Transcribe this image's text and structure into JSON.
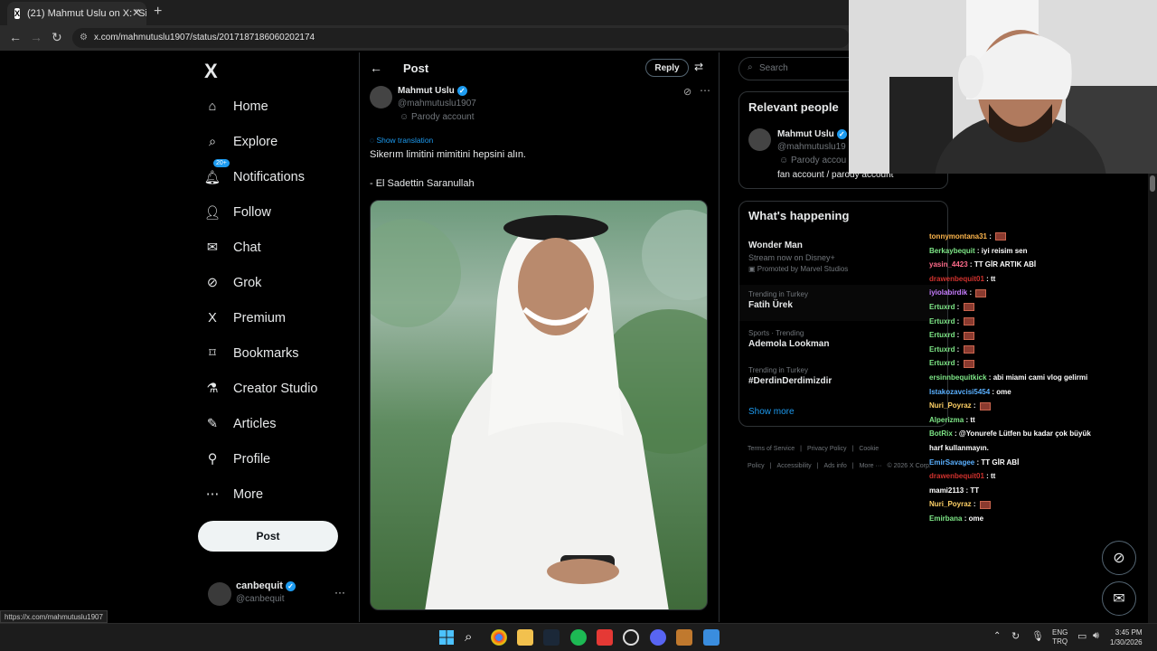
{
  "browser": {
    "tab_title": "(21) Mahmut Uslu on X: \"Sikeri",
    "tab_favicon": "X",
    "close_glyph": "✕",
    "newtab_glyph": "+",
    "url": "x.com/mahmutuslu1907/status/2017187186060202174",
    "status_url": "https://x.com/mahmutuslu1907"
  },
  "nav": {
    "logo": "X",
    "items": [
      {
        "label": "Home",
        "icon": "home-icon",
        "glyph": "⌂"
      },
      {
        "label": "Explore",
        "icon": "search-icon",
        "glyph": "⌕"
      },
      {
        "label": "Notifications",
        "icon": "bell-icon",
        "glyph": "🔔︎",
        "badge": "20+"
      },
      {
        "label": "Follow",
        "icon": "person-add-icon",
        "glyph": "👤︎"
      },
      {
        "label": "Chat",
        "icon": "mail-icon",
        "glyph": "✉"
      },
      {
        "label": "Grok",
        "icon": "grok-icon",
        "glyph": "⊘"
      },
      {
        "label": "Premium",
        "icon": "x-icon",
        "glyph": "X"
      },
      {
        "label": "Bookmarks",
        "icon": "bookmark-icon",
        "glyph": "⌑"
      },
      {
        "label": "Creator Studio",
        "icon": "flask-icon",
        "glyph": "⚗"
      },
      {
        "label": "Articles",
        "icon": "article-icon",
        "glyph": "✎"
      },
      {
        "label": "Profile",
        "icon": "person-icon",
        "glyph": "⚲"
      },
      {
        "label": "More",
        "icon": "more-circle-icon",
        "glyph": "⋯"
      }
    ],
    "post_button": "Post",
    "account": {
      "name": "canbequit",
      "handle": "@canbequit",
      "menu": "···"
    }
  },
  "post": {
    "header_title": "Post",
    "reply_button": "Reply",
    "author_name": "Mahmut Uslu",
    "author_handle": "@mahmutuslu1907",
    "parody_label": "Parody account",
    "show_translation": "Show translation",
    "text_line1": "Sikerım limitini mimitini hepsini alın.",
    "text_line2": "- El Sadettin Saranullah"
  },
  "right": {
    "search_placeholder": "Search",
    "relevant_title": "Relevant people",
    "relevant_name": "Mahmut Uslu",
    "relevant_handle": "@mahmutuslu19",
    "relevant_parody": "Parody accou",
    "relevant_bio": "fan account / parody account",
    "happening_title": "What's happening",
    "trends": [
      {
        "title": "Wonder Man",
        "sub": "Stream now on Disney+",
        "promo": "Promoted by Marvel Studios"
      },
      {
        "cat": "Trending in Turkey",
        "title": "Fatih Ürek"
      },
      {
        "cat": "Sports · Trending",
        "title": "Ademola Lookman"
      },
      {
        "cat": "Trending in Turkey",
        "title": "#DerdinDerdimizdir"
      }
    ],
    "show_more": "Show more",
    "footer": [
      "Terms of Service",
      "|",
      "Privacy Policy",
      "|",
      "Cookie Policy",
      "|",
      "Accessibility",
      "|",
      "Ads info",
      "|",
      "More ···",
      "© 2026 X Corp."
    ]
  },
  "chat": [
    {
      "user": "tonnymontana31",
      "color": "#ffb74d",
      "text": "",
      "emote": true
    },
    {
      "user": "Berkaybequit",
      "color": "#7ee787",
      "text": "iyi reisim sen",
      "emote": false
    },
    {
      "user": "yasin_4423",
      "color": "#ff6b8b",
      "text": "TT GİR ARTIK ABİ",
      "emote": false
    },
    {
      "user": "drawenbequit01",
      "color": "#d0312d",
      "text": "tt",
      "emote": false
    },
    {
      "user": "iyiolabirdik",
      "color": "#c77dff",
      "text": "",
      "emote": true
    },
    {
      "user": "Ertuxrd",
      "color": "#7ee787",
      "text": "",
      "emote": true
    },
    {
      "user": "Ertuxrd",
      "color": "#7ee787",
      "text": "",
      "emote": true
    },
    {
      "user": "Ertuxrd",
      "color": "#7ee787",
      "text": "",
      "emote": true
    },
    {
      "user": "Ertuxrd",
      "color": "#7ee787",
      "text": "",
      "emote": true
    },
    {
      "user": "Ertuxrd",
      "color": "#7ee787",
      "text": "",
      "emote": true
    },
    {
      "user": "ersinnbequitkick",
      "color": "#7ee787",
      "text": "abi miami cami vlog gelirmi",
      "emote": false
    },
    {
      "user": "Istakozavcisi5454",
      "color": "#5ab0ff",
      "text": "ome",
      "emote": false
    },
    {
      "user": "Nuri_Poyraz",
      "color": "#ffd166",
      "text": "",
      "emote": true
    },
    {
      "user": "Alperizma",
      "color": "#7ee787",
      "text": "tt",
      "emote": false
    },
    {
      "user": "BotRix",
      "color": "#7ee787",
      "text": "@Yonurefe Lütfen bu kadar çok büyük",
      "emote": false
    },
    {
      "user": "",
      "color": "#ffffff",
      "text": "harf kullanmayın.",
      "emote": false
    },
    {
      "user": "EmirSavagee",
      "color": "#5ab0ff",
      "text": "TT GİR ABİ",
      "emote": false
    },
    {
      "user": "drawenbequit01",
      "color": "#d0312d",
      "text": "tt",
      "emote": false
    },
    {
      "user": "mami2113",
      "color": "#ffffff",
      "text": "TT",
      "emote": false
    },
    {
      "user": "Nuri_Poyraz",
      "color": "#ffd166",
      "text": "",
      "emote": true
    },
    {
      "user": "Emirbana",
      "color": "#7ee787",
      "text": "ome",
      "emote": false
    }
  ],
  "taskbar": {
    "lang1": "ENG",
    "lang2": "TRQ",
    "time": "3:45 PM",
    "date": "1/30/2026"
  },
  "colors": {
    "accent": "#1d9bf0",
    "bg": "#000000",
    "border": "#2f3336"
  }
}
